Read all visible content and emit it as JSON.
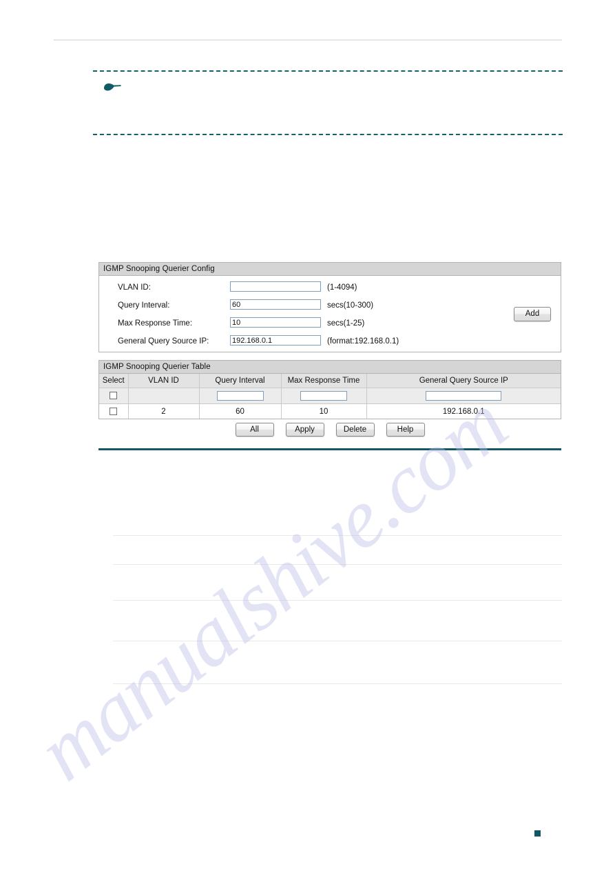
{
  "page": {
    "marker_label": "",
    "background_hex": "#ffffff",
    "accent_teal_hex": "#125864",
    "rule_gray_hex": "#e6e7e8"
  },
  "watermark": {
    "text": "manualshive.com"
  },
  "note": {
    "icon": "pointing-hand-icon",
    "body_text": "",
    "border_color_hex": "#14606c"
  },
  "config_panel": {
    "title": "IGMP Snooping Querier Config",
    "rows": [
      {
        "label": "VLAN ID:",
        "value": "",
        "placeholder": "",
        "hint": "(1-4094)"
      },
      {
        "label": "Query Interval:",
        "value": "60",
        "placeholder": "",
        "hint": "secs(10-300)"
      },
      {
        "label": "Max Response Time:",
        "value": "10",
        "placeholder": "",
        "hint": "secs(1-25)"
      },
      {
        "label": "General Query Source IP:",
        "value": "192.168.0.1",
        "placeholder": "",
        "hint": "(format:192.168.0.1)"
      }
    ],
    "add_label": "Add"
  },
  "table_panel": {
    "title": "IGMP Snooping Querier Table",
    "columns": [
      "Select",
      "VLAN ID",
      "Query Interval",
      "Max Response Time",
      "General Query Source IP"
    ],
    "filter_row": {
      "select": "",
      "vlan_id": "",
      "query_interval": "",
      "max_response_time": "",
      "source_ip": ""
    },
    "rows": [
      {
        "select": "",
        "vlan_id": "2",
        "query_interval": "60",
        "max_response_time": "10",
        "source_ip": "192.168.0.1"
      }
    ]
  },
  "action_buttons": [
    {
      "label": "All"
    },
    {
      "label": "Apply"
    },
    {
      "label": "Delete"
    },
    {
      "label": "Help"
    }
  ]
}
